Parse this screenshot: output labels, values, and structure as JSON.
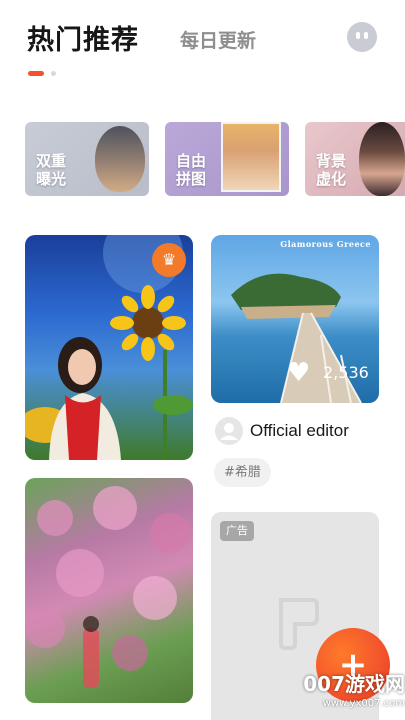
{
  "header": {
    "tab_active": "热门推荐",
    "tab_inactive": "每日更新",
    "avatar_icon": "user-avatar-icon"
  },
  "tools": [
    {
      "label": "双重曝光"
    },
    {
      "label": "自由拼图"
    },
    {
      "label": "背景虚化"
    }
  ],
  "feed": {
    "post": {
      "image_caption": "Glamorous Greece",
      "likes": "2,536",
      "author": "Official editor",
      "tag": "#希腊"
    },
    "ad": {
      "label": "广告"
    }
  },
  "fab": {
    "symbol": "+"
  },
  "watermark": {
    "text": "007游戏网",
    "url": "www.yx007.com"
  },
  "colors": {
    "accent": "#f2532c",
    "inactive_tab": "#8e8e8e"
  }
}
